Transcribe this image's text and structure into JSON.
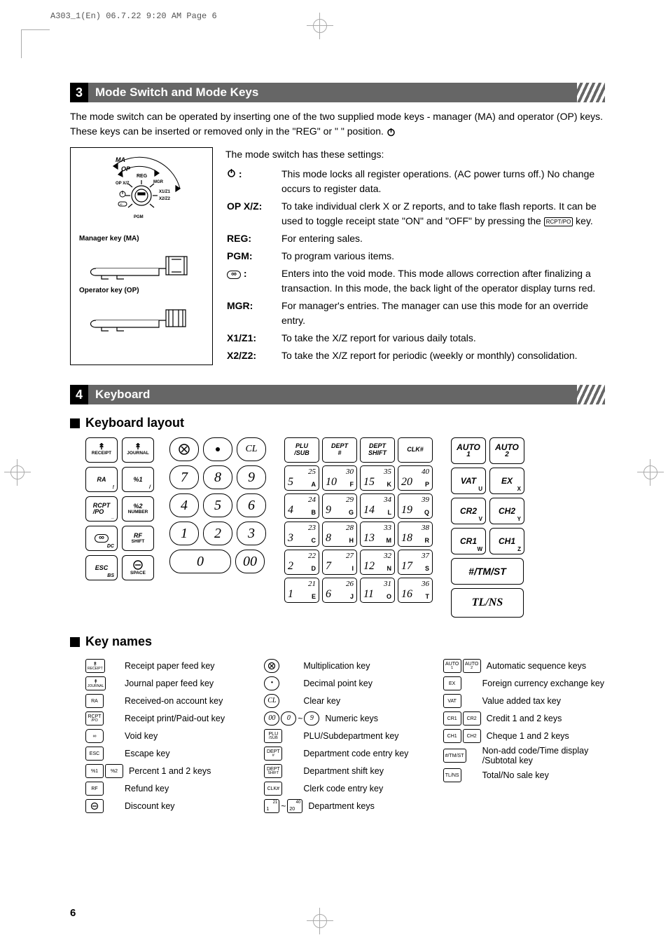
{
  "print_header": "A303_1(En)  06.7.22 9:20 AM  Page 6",
  "page_number": "6",
  "section3": {
    "num": "3",
    "title": "Mode Switch and Mode Keys",
    "intro": "The mode switch can be operated by inserting one of the two supplied mode keys - manager (MA) and operator (OP) keys.  These keys can be inserted or removed only in the \"REG\" or \" \" position.",
    "dial_labels": {
      "reg": "REG",
      "opxz": "OP X/Z",
      "mgr": "MGR",
      "pgm": "PGM",
      "x1z1": "X1/Z1",
      "x2z2": "X2/Z2",
      "ma": "MA",
      "op": "OP"
    },
    "manager_key": "Manager key (MA)",
    "operator_key": "Operator key (OP)",
    "settings_intro": "The mode switch has these settings:",
    "rows": [
      {
        "label_icon": "power",
        "label": " :",
        "desc": "This mode locks all register operations. (AC power turns off.) No change occurs to register data."
      },
      {
        "label": "OP X/Z:",
        "desc": "To take individual clerk X or Z reports, and to take flash reports. It can be used to toggle receipt state \"ON\" and \"OFF\" by pressing the",
        "tail_box": "RCPT/PO",
        "tail": " key."
      },
      {
        "label": "REG:",
        "desc": "For entering sales."
      },
      {
        "label": "PGM:",
        "desc": "To program various items."
      },
      {
        "label_icon": "void",
        "label": " :",
        "desc": "Enters into the void mode.  This mode allows correction after finalizing a transaction. In this mode, the back light of the operator display turns red."
      },
      {
        "label": "MGR:",
        "desc": "For manager's entries.  The manager can use this mode for an override entry."
      },
      {
        "label": "X1/Z1:",
        "desc": "To take the X/Z report for various daily totals."
      },
      {
        "label": "X2/Z2:",
        "desc": "To take the X/Z report for periodic (weekly or monthly) consolidation."
      }
    ]
  },
  "section4": {
    "num": "4",
    "title": "Keyboard",
    "sub1": "Keyboard layout",
    "sub2": "Key names",
    "left_keys": [
      [
        {
          "t": "↑",
          "b": "RECEIPT"
        },
        {
          "t": "↑",
          "b": "JOURNAL"
        }
      ],
      [
        {
          "t": "RA",
          "br": "!"
        },
        {
          "t": "%1",
          "br": "/"
        }
      ],
      [
        {
          "t": "RCPT /PO",
          "br": "_"
        },
        {
          "t": "%2",
          "b": "NUMBER"
        }
      ],
      [
        {
          "t": "void",
          "br": "DC"
        },
        {
          "t": "RF",
          "b": "SHIFT"
        }
      ],
      [
        {
          "t": "ESC",
          "br": "BS"
        },
        {
          "t": "⊖",
          "b": "SPACE"
        }
      ]
    ],
    "numpad": [
      [
        "⊗",
        "•",
        "CL"
      ],
      [
        "7",
        "8",
        "9"
      ],
      [
        "4",
        "5",
        "6"
      ],
      [
        "1",
        "2",
        "3"
      ],
      [
        "0",
        "00"
      ]
    ],
    "dept_top": [
      "PLU\n/SUB",
      "DEPT\n#",
      "DEPT\nSHIFT",
      "CLK#"
    ],
    "dept_grid": [
      [
        {
          "t": "25",
          "b": "5",
          "l": "A"
        },
        {
          "t": "30",
          "b": "10",
          "l": "F"
        },
        {
          "t": "35",
          "b": "15",
          "l": "K"
        },
        {
          "t": "40",
          "b": "20",
          "l": "P"
        }
      ],
      [
        {
          "t": "24",
          "b": "4",
          "l": "B"
        },
        {
          "t": "29",
          "b": "9",
          "l": "G"
        },
        {
          "t": "34",
          "b": "14",
          "l": "L"
        },
        {
          "t": "39",
          "b": "19",
          "l": "Q"
        }
      ],
      [
        {
          "t": "23",
          "b": "3",
          "l": "C"
        },
        {
          "t": "28",
          "b": "8",
          "l": "H"
        },
        {
          "t": "33",
          "b": "13",
          "l": "M"
        },
        {
          "t": "38",
          "b": "18",
          "l": "R"
        }
      ],
      [
        {
          "t": "22",
          "b": "2",
          "l": "D"
        },
        {
          "t": "27",
          "b": "7",
          "l": "I"
        },
        {
          "t": "32",
          "b": "12",
          "l": "N"
        },
        {
          "t": "37",
          "b": "17",
          "l": "S"
        }
      ],
      [
        {
          "t": "21",
          "b": "1",
          "l": "E"
        },
        {
          "t": "26",
          "b": "6",
          "l": "J"
        },
        {
          "t": "31",
          "b": "11",
          "l": "O"
        },
        {
          "t": "36",
          "b": "16",
          "l": "T"
        }
      ]
    ],
    "right_keys": [
      [
        {
          "t": "AUTO",
          "s": "1"
        },
        {
          "t": "AUTO",
          "s": "2"
        }
      ],
      [
        {
          "t": "VAT",
          "sub": "U"
        },
        {
          "t": "EX",
          "sub": "X"
        }
      ],
      [
        {
          "t": "CR2",
          "sub": "V"
        },
        {
          "t": "CH2",
          "sub": "Y"
        }
      ],
      [
        {
          "t": "CR1",
          "sub": "W"
        },
        {
          "t": "CH1",
          "sub": "Z"
        }
      ],
      [
        {
          "wide": "#/TM/ST"
        }
      ],
      [
        {
          "wide": "TL/NS"
        }
      ]
    ],
    "keynames": {
      "col1": [
        {
          "icon": [
            {
              "txt": "↑",
              "sub": "RECEIPT"
            }
          ],
          "label": "Receipt paper feed key"
        },
        {
          "icon": [
            {
              "txt": "↑",
              "sub": "JOURNAL"
            }
          ],
          "label": "Journal paper feed key"
        },
        {
          "icon": [
            {
              "txt": "RA"
            }
          ],
          "label": "Received-on account key"
        },
        {
          "icon": [
            {
              "txt": "RCPT",
              "sub": "/PO"
            }
          ],
          "label": "Receipt print/Paid-out key"
        },
        {
          "icon": [
            {
              "txt": "∞"
            }
          ],
          "label": "Void key"
        },
        {
          "icon": [
            {
              "txt": "ESC"
            }
          ],
          "label": "Escape key"
        },
        {
          "icon": [
            {
              "txt": "%1"
            },
            {
              "txt": "%2"
            }
          ],
          "label": "Percent 1 and 2 keys"
        },
        {
          "icon": [
            {
              "txt": "RF"
            }
          ],
          "label": "Refund key"
        },
        {
          "icon": [
            {
              "txt": "⊖"
            }
          ],
          "label": "Discount key"
        }
      ],
      "col2": [
        {
          "icon": [
            {
              "round": "⊗"
            }
          ],
          "label": "Multiplication key"
        },
        {
          "icon": [
            {
              "round": "•"
            }
          ],
          "label": "Decimal point key"
        },
        {
          "icon": [
            {
              "round": "CL"
            }
          ],
          "label": "Clear key"
        },
        {
          "icon": [
            {
              "round": "00"
            },
            {
              "round": "0"
            },
            {
              "tilde": "~"
            },
            {
              "round": "9"
            }
          ],
          "label": "Numeric keys"
        },
        {
          "icon": [
            {
              "txt": "PLU",
              "sub": "/SUB"
            }
          ],
          "label": "PLU/Subdepartment key"
        },
        {
          "icon": [
            {
              "txt": "DEPT",
              "sub": "#"
            }
          ],
          "label": "Department code entry key"
        },
        {
          "icon": [
            {
              "txt": "DEPT",
              "sub": "SHIFT"
            }
          ],
          "label": "Department shift key"
        },
        {
          "icon": [
            {
              "txt": "CLK#"
            }
          ],
          "label": "Clerk code entry key"
        },
        {
          "icon": [
            {
              "dept": {
                "a": "21",
                "b": "1"
              }
            },
            {
              "tilde": "~"
            },
            {
              "dept": {
                "a": "40",
                "b": "20"
              }
            }
          ],
          "label": "Department keys"
        }
      ],
      "col3": [
        {
          "icon": [
            {
              "txt": "AUTO",
              "sub": "1"
            },
            {
              "txt": "AUTO",
              "sub": "2"
            }
          ],
          "label": "Automatic sequence keys"
        },
        {
          "icon": [
            {
              "txt": "EX"
            }
          ],
          "label": "Foreign currency exchange key"
        },
        {
          "icon": [
            {
              "txt": "VAT"
            }
          ],
          "label": "Value added tax key"
        },
        {
          "icon": [
            {
              "txt": "CR1"
            },
            {
              "txt": "CR2"
            }
          ],
          "label": "Credit 1 and 2 keys"
        },
        {
          "icon": [
            {
              "txt": "CH1"
            },
            {
              "txt": "CH2"
            }
          ],
          "label": "Cheque 1 and 2 keys"
        },
        {
          "icon": [
            {
              "txt": "#/TM/ST"
            }
          ],
          "label": "Non-add code/Time display /Subtotal key"
        },
        {
          "icon": [
            {
              "txt": "TL/NS"
            }
          ],
          "label": "Total/No sale key"
        }
      ]
    }
  }
}
